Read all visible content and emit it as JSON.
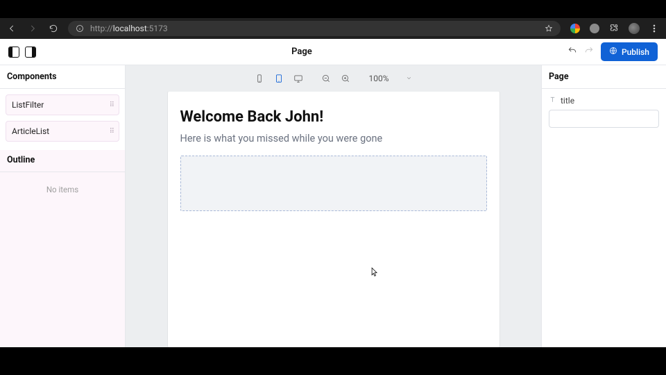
{
  "browser": {
    "url_prefix": "http://",
    "url_host": "localhost",
    "url_port": ":5173"
  },
  "topbar": {
    "title": "Page",
    "publish_label": "Publish"
  },
  "left_panel": {
    "components_header": "Components",
    "outline_header": "Outline",
    "outline_empty": "No items",
    "components": [
      {
        "name": "ListFilter"
      },
      {
        "name": "ArticleList"
      }
    ]
  },
  "canvas": {
    "zoom": "100%",
    "page": {
      "heading": "Welcome Back John!",
      "subheading": "Here is what you missed while you were gone"
    }
  },
  "right_panel": {
    "header": "Page",
    "prop_label": "title",
    "prop_value": ""
  }
}
